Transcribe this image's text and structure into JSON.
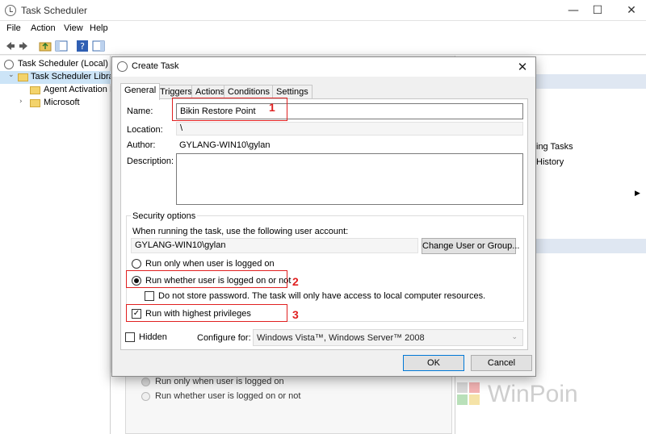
{
  "window": {
    "title": "Task Scheduler",
    "controls": {
      "minimize": "—",
      "maximize": "☐",
      "close": "✕"
    }
  },
  "menu": [
    "File",
    "Action",
    "View",
    "Help"
  ],
  "tree": {
    "items": [
      {
        "label": "Task Scheduler (Local)"
      },
      {
        "label": "Task Scheduler Library"
      },
      {
        "label": "Agent Activation Ru"
      },
      {
        "label": "Microsoft"
      }
    ]
  },
  "right_panel": {
    "partial_texts": [
      "ing Tasks",
      "History"
    ],
    "arrow": "▶"
  },
  "background_options": {
    "opt1": "Run only when user is logged on",
    "opt2": "Run whether user is logged on or not"
  },
  "watermark": {
    "text": "WinPoin"
  },
  "dialog": {
    "title": "Create Task",
    "close": "✕",
    "tabs": [
      "General",
      "Triggers",
      "Actions",
      "Conditions",
      "Settings"
    ],
    "name_label": "Name:",
    "name_value": "Bikin Restore Point",
    "location_label": "Location:",
    "location_value": "\\",
    "author_label": "Author:",
    "author_value": "GYLANG-WIN10\\gylan",
    "description_label": "Description:",
    "security": {
      "title": "Security options",
      "account_prompt": "When running the task, use the following user account:",
      "account": "GYLANG-WIN10\\gylan",
      "change_button": "Change User or Group...",
      "opt_logged_on": "Run only when user is logged on",
      "opt_whether": "Run whether user is logged on or not",
      "no_store_password": "Do not store password.  The task will only have access to local computer resources.",
      "highest_privileges": "Run with highest privileges",
      "selected_option": "Run whether user is logged on or not",
      "highest_privileges_checked": true,
      "no_store_password_checked": false
    },
    "hidden_label": "Hidden",
    "hidden_checked": false,
    "configure_label": "Configure for:",
    "configure_value": "Windows Vista™, Windows Server™ 2008",
    "ok": "OK",
    "cancel": "Cancel"
  },
  "annotations": [
    "1",
    "2",
    "3"
  ],
  "colors": {
    "annotation": "#e02020",
    "accent": "#0078d7",
    "watermark": "#cfcfcf"
  }
}
